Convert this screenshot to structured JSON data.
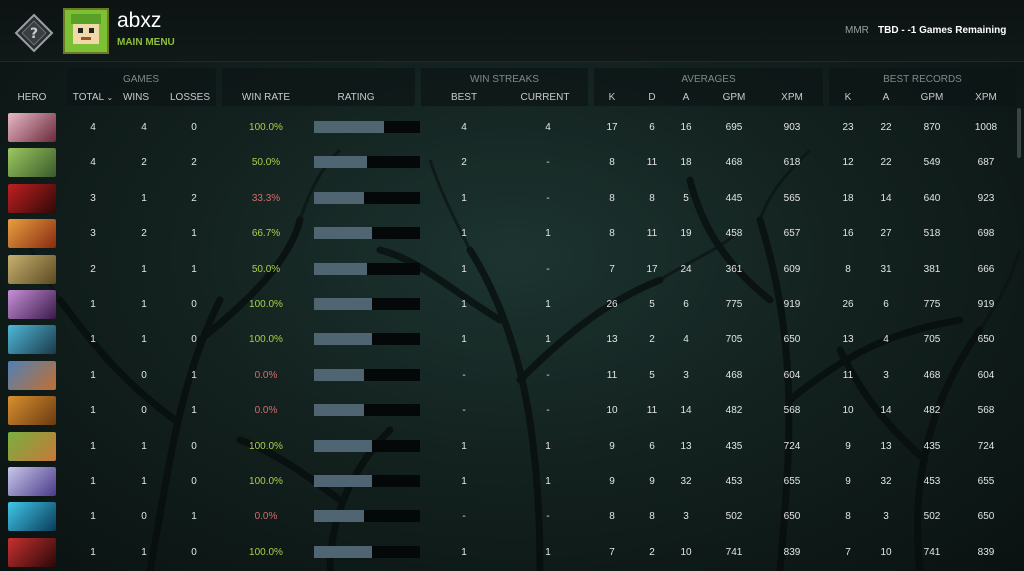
{
  "profile": {
    "username": "abxz",
    "main_menu": "MAIN MENU",
    "mmr_label": "MMR",
    "mmr_value": "TBD - -1 Games Remaining"
  },
  "groups": {
    "games": "GAMES",
    "win_streaks": "WIN STREAKS",
    "averages": "AVERAGES",
    "best_records": "BEST RECORDS"
  },
  "columns": {
    "hero": "HERO",
    "total": "TOTAL",
    "wins": "WINS",
    "losses": "LOSSES",
    "win_rate": "WIN RATE",
    "rating": "RATING",
    "best": "BEST",
    "current": "CURRENT",
    "avg_k": "K",
    "avg_d": "D",
    "avg_a": "A",
    "avg_gpm": "GPM",
    "avg_xpm": "XPM",
    "rec_k": "K",
    "rec_a": "A",
    "rec_gpm": "GPM",
    "rec_xpm": "XPM"
  },
  "colors": {
    "bar": "#4f6672",
    "win_rate_good": "#a8d14a",
    "win_rate_bad": "#d86a6a",
    "accent": "#8cbf3a"
  },
  "rows": [
    {
      "hero_color": [
        "#e8b8c8",
        "#6a2a3a"
      ],
      "total": "4",
      "wins": "4",
      "losses": "0",
      "win_rate": "100.0%",
      "rating": 0.66,
      "best": "4",
      "current": "4",
      "k": "17",
      "d": "6",
      "a": "16",
      "gpm": "695",
      "xpm": "903",
      "rk": "23",
      "ra": "22",
      "rgpm": "870",
      "rxpm": "1008"
    },
    {
      "hero_color": [
        "#9cc860",
        "#3a5a2a"
      ],
      "total": "4",
      "wins": "2",
      "losses": "2",
      "win_rate": "50.0%",
      "rating": 0.5,
      "best": "2",
      "current": "-",
      "k": "8",
      "d": "11",
      "a": "18",
      "gpm": "468",
      "xpm": "618",
      "rk": "12",
      "ra": "22",
      "rgpm": "549",
      "rxpm": "687"
    },
    {
      "hero_color": [
        "#c02020",
        "#300808"
      ],
      "total": "3",
      "wins": "1",
      "losses": "2",
      "win_rate": "33.3%",
      "rating": 0.47,
      "best": "1",
      "current": "-",
      "k": "8",
      "d": "8",
      "a": "5",
      "gpm": "445",
      "xpm": "565",
      "rk": "18",
      "ra": "14",
      "rgpm": "640",
      "rxpm": "923"
    },
    {
      "hero_color": [
        "#e8a040",
        "#8a2a10"
      ],
      "total": "3",
      "wins": "2",
      "losses": "1",
      "win_rate": "66.7%",
      "rating": 0.55,
      "best": "1",
      "current": "1",
      "k": "8",
      "d": "11",
      "a": "19",
      "gpm": "458",
      "xpm": "657",
      "rk": "16",
      "ra": "27",
      "rgpm": "518",
      "rxpm": "698"
    },
    {
      "hero_color": [
        "#c8b070",
        "#5a4a20"
      ],
      "total": "2",
      "wins": "1",
      "losses": "1",
      "win_rate": "50.0%",
      "rating": 0.5,
      "best": "1",
      "current": "-",
      "k": "7",
      "d": "17",
      "a": "24",
      "gpm": "361",
      "xpm": "609",
      "rk": "8",
      "ra": "31",
      "rgpm": "381",
      "rxpm": "666"
    },
    {
      "hero_color": [
        "#c890d8",
        "#3a1a4a"
      ],
      "total": "1",
      "wins": "1",
      "losses": "0",
      "win_rate": "100.0%",
      "rating": 0.55,
      "best": "1",
      "current": "1",
      "k": "26",
      "d": "5",
      "a": "6",
      "gpm": "775",
      "xpm": "919",
      "rk": "26",
      "ra": "6",
      "rgpm": "775",
      "rxpm": "919"
    },
    {
      "hero_color": [
        "#50b8d8",
        "#1a3a4a"
      ],
      "total": "1",
      "wins": "1",
      "losses": "0",
      "win_rate": "100.0%",
      "rating": 0.55,
      "best": "1",
      "current": "1",
      "k": "13",
      "d": "2",
      "a": "4",
      "gpm": "705",
      "xpm": "650",
      "rk": "13",
      "ra": "4",
      "rgpm": "705",
      "rxpm": "650"
    },
    {
      "hero_color": [
        "#5080b8",
        "#c07030"
      ],
      "total": "1",
      "wins": "0",
      "losses": "1",
      "win_rate": "0.0%",
      "rating": 0.47,
      "best": "-",
      "current": "-",
      "k": "11",
      "d": "5",
      "a": "3",
      "gpm": "468",
      "xpm": "604",
      "rk": "11",
      "ra": "3",
      "rgpm": "468",
      "rxpm": "604"
    },
    {
      "hero_color": [
        "#d89030",
        "#6a3a10"
      ],
      "total": "1",
      "wins": "0",
      "losses": "1",
      "win_rate": "0.0%",
      "rating": 0.47,
      "best": "-",
      "current": "-",
      "k": "10",
      "d": "11",
      "a": "14",
      "gpm": "482",
      "xpm": "568",
      "rk": "10",
      "ra": "14",
      "rgpm": "482",
      "rxpm": "568"
    },
    {
      "hero_color": [
        "#78b040",
        "#c87838"
      ],
      "total": "1",
      "wins": "1",
      "losses": "0",
      "win_rate": "100.0%",
      "rating": 0.55,
      "best": "1",
      "current": "1",
      "k": "9",
      "d": "6",
      "a": "13",
      "gpm": "435",
      "xpm": "724",
      "rk": "9",
      "ra": "13",
      "rgpm": "435",
      "rxpm": "724"
    },
    {
      "hero_color": [
        "#c8c8e8",
        "#4a3a8a"
      ],
      "total": "1",
      "wins": "1",
      "losses": "0",
      "win_rate": "100.0%",
      "rating": 0.55,
      "best": "1",
      "current": "1",
      "k": "9",
      "d": "9",
      "a": "32",
      "gpm": "453",
      "xpm": "655",
      "rk": "9",
      "ra": "32",
      "rgpm": "453",
      "rxpm": "655"
    },
    {
      "hero_color": [
        "#40c8e8",
        "#0a3a5a"
      ],
      "total": "1",
      "wins": "0",
      "losses": "1",
      "win_rate": "0.0%",
      "rating": 0.47,
      "best": "-",
      "current": "-",
      "k": "8",
      "d": "8",
      "a": "3",
      "gpm": "502",
      "xpm": "650",
      "rk": "8",
      "ra": "3",
      "rgpm": "502",
      "rxpm": "650"
    },
    {
      "hero_color": [
        "#c83030",
        "#2a0808"
      ],
      "total": "1",
      "wins": "1",
      "losses": "0",
      "win_rate": "100.0%",
      "rating": 0.55,
      "best": "1",
      "current": "1",
      "k": "7",
      "d": "2",
      "a": "10",
      "gpm": "741",
      "xpm": "839",
      "rk": "7",
      "ra": "10",
      "rgpm": "741",
      "rxpm": "839"
    }
  ]
}
